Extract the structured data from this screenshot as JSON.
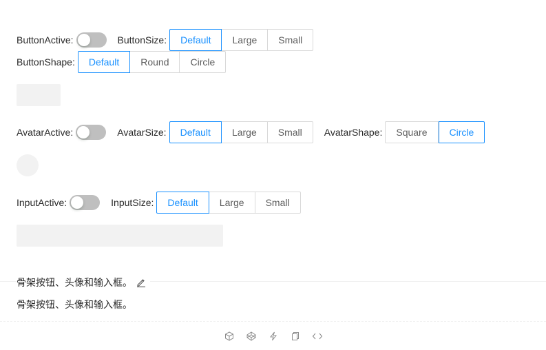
{
  "button": {
    "active_label": "ButtonActive:",
    "size_label": "ButtonSize:",
    "size_options": [
      "Default",
      "Large",
      "Small"
    ],
    "size_selected": "Default",
    "shape_label": "ButtonShape:",
    "shape_options": [
      "Default",
      "Round",
      "Circle"
    ],
    "shape_selected": "Default"
  },
  "avatar": {
    "active_label": "AvatarActive:",
    "size_label": "AvatarSize:",
    "size_options": [
      "Default",
      "Large",
      "Small"
    ],
    "size_selected": "Default",
    "shape_label": "AvatarShape:",
    "shape_options": [
      "Square",
      "Circle"
    ],
    "shape_selected": "Circle"
  },
  "input": {
    "active_label": "InputActive:",
    "size_label": "InputSize:",
    "size_options": [
      "Default",
      "Large",
      "Small"
    ],
    "size_selected": "Default"
  },
  "meta": {
    "title": "骨架按钮、头像和输入框。",
    "description": "骨架按钮、头像和输入框。"
  },
  "colors": {
    "primary": "#1890ff",
    "switch_off": "#bfbfbf",
    "skeleton": "#f2f2f2"
  },
  "icons": [
    "codesandbox-icon",
    "codepen-icon",
    "thunder-icon",
    "copy-icon",
    "code-icon"
  ]
}
